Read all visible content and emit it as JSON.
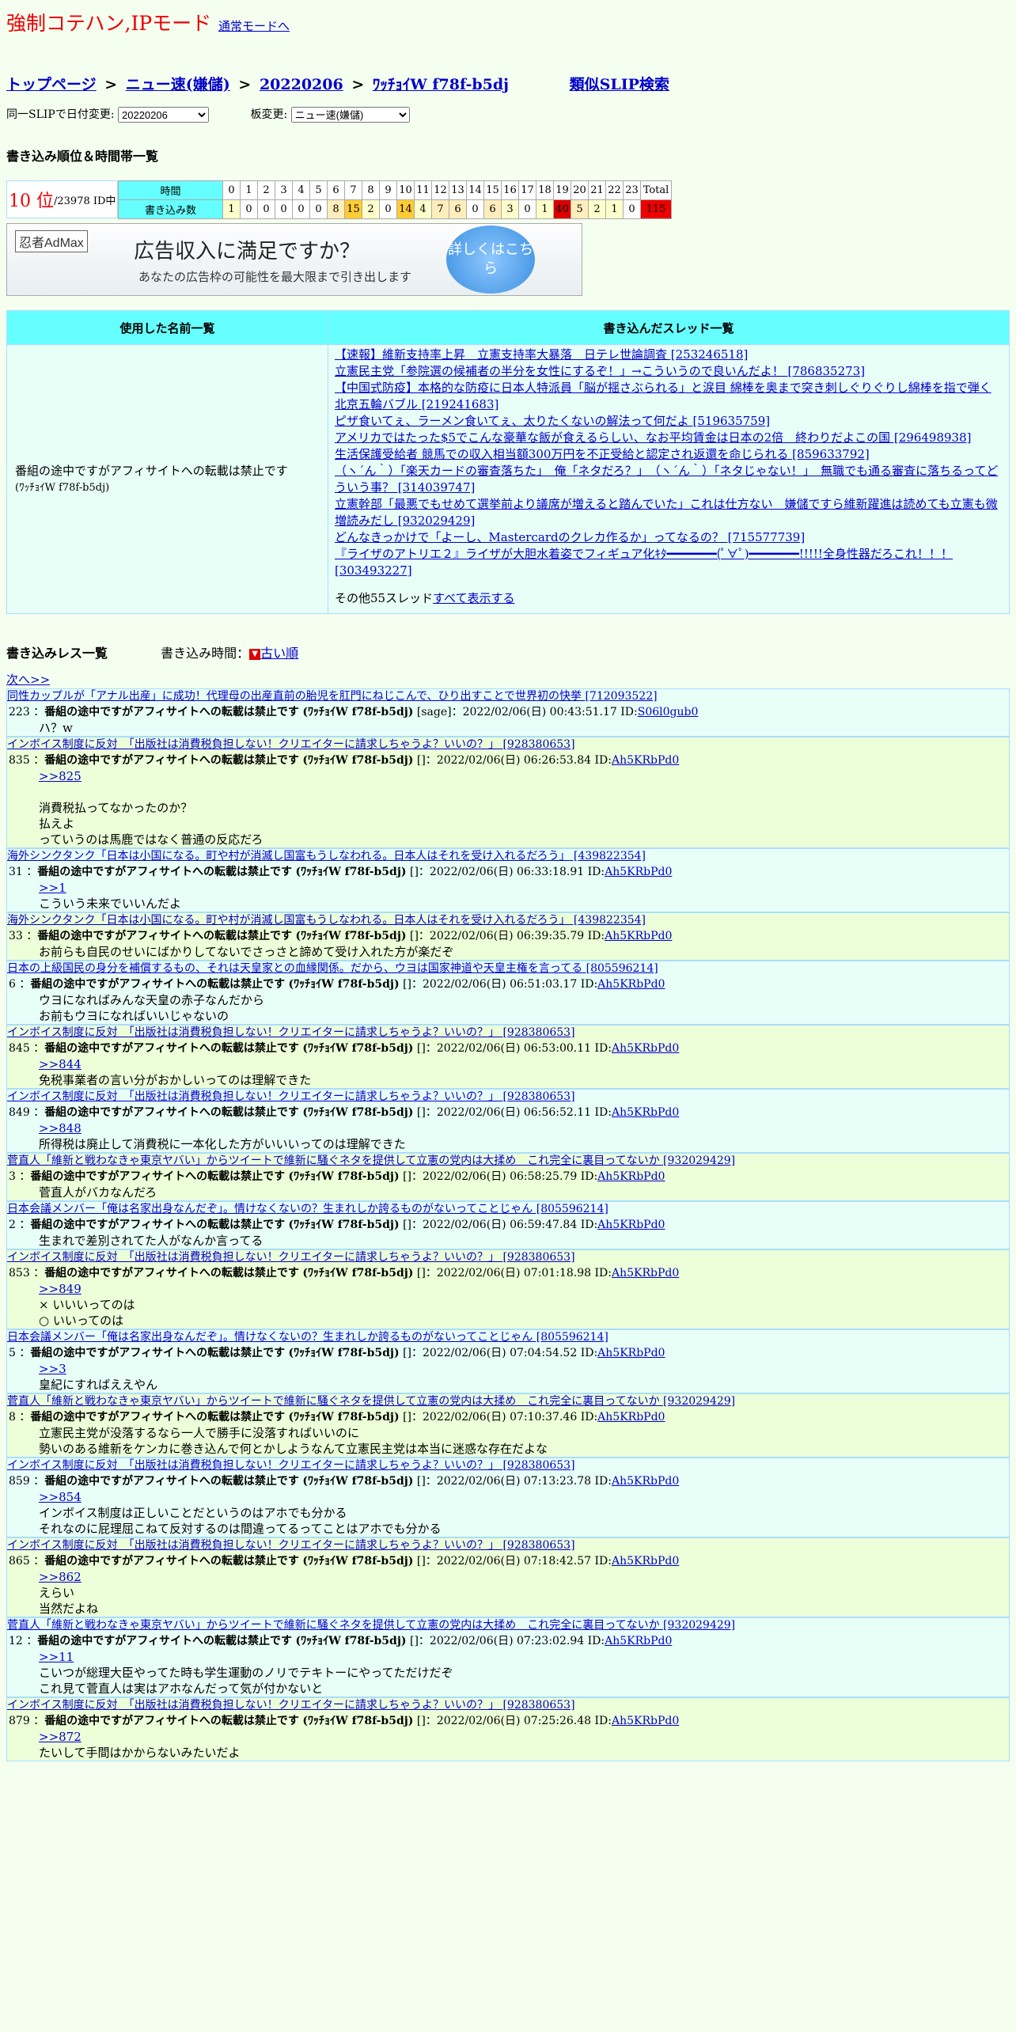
{
  "mode_title": "強制コテハン,IPモード",
  "normal_mode_link": "通常モードへ",
  "breadcrumb": {
    "top": "トップページ",
    "sep": ">",
    "board": "ニュー速(嫌儲)",
    "date": "20220206",
    "slip": "ﾜｯﾁｮｲW f78f-b5dj",
    "similar": "類似SLIP検索"
  },
  "selectors": {
    "date_label": "同一SLIPで日付変更:",
    "date_value": "20220206",
    "board_label": "板変更:",
    "board_value": "ニュー速(嫌儲)"
  },
  "rank_section_title": "書き込み順位＆時間帯一覧",
  "rank": {
    "value": "10 位",
    "total": "/23978 ID中"
  },
  "hours_table": {
    "time_label": "時間",
    "count_label": "書き込み数",
    "total_label": "Total",
    "hours": [
      "0",
      "1",
      "2",
      "3",
      "4",
      "5",
      "6",
      "7",
      "8",
      "9",
      "10",
      "11",
      "12",
      "13",
      "14",
      "15",
      "16",
      "17",
      "18",
      "19",
      "20",
      "21",
      "22",
      "23"
    ],
    "counts": [
      "1",
      "0",
      "0",
      "0",
      "0",
      "0",
      "8",
      "15",
      "2",
      "0",
      "14",
      "4",
      "7",
      "6",
      "0",
      "6",
      "3",
      "0",
      "1",
      "40",
      "5",
      "2",
      "1",
      "0"
    ],
    "total": "115",
    "colors": [
      "#ffffcc",
      "#ffffff",
      "#ffffff",
      "#ffffff",
      "#ffffff",
      "#ffffff",
      "#ffeebb",
      "#ffcc33",
      "#ffffcc",
      "#ffffff",
      "#ffcc33",
      "#ffffcc",
      "#ffeebb",
      "#ffeebb",
      "#ffffff",
      "#ffeebb",
      "#ffffcc",
      "#ffffff",
      "#ffffcc",
      "#dd0000",
      "#ffeebb",
      "#ffffcc",
      "#ffffcc",
      "#ffffff"
    ],
    "total_color": "#ee0000"
  },
  "ad": {
    "brand": "忍者AdMax",
    "headline": "広告収入に満足ですか？",
    "sub": "あなたの広告枠の可能性を最大限まで引き出します",
    "button": "詳しくはこちら"
  },
  "main_table": {
    "col_names": "使用した名前一覧",
    "col_threads": "書き込んだスレッド一覧",
    "name": "番組の途中ですがアフィサイトへの転載は禁止です",
    "name_slip": "(ﾜｯﾁｮｲW f78f-b5dj)",
    "threads": [
      "【速報】維新支持率上昇　立憲支持率大暴落　日テレ世論調査 [253246518]",
      "立憲民主党「参院選の候補者の半分を女性にするぞ！」→こういうので良いんだよ！ [786835273]",
      "【中国式防疫】本格的な防疫に日本人特派員「脳が揺さぶられる」と涙目 綿棒を奥まで突き刺しぐりぐりし綿棒を指で弾く 北京五輪バブル [219241683]",
      "ピザ食いてぇ、ラーメン食いてぇ、太りたくないの解法って何だよ [519635759]",
      "アメリカではたった$5でこんな豪華な飯が食えるらしい、なお平均賃金は日本の2倍　終わりだよこの国 [296498938]",
      "生活保護受給者 競馬での収入相当額300万円を不正受給と認定され返還を命じられる [859633792]",
      "（ヽ´ん｀）「楽天カードの審査落ちた」　俺「ネタだろ？」　（ヽ´ん｀）「ネタじゃない！」　無職でも通る審査に落ちるってどういう事？ [314039747]",
      "立憲幹部「最悪でもせめて選挙前より議席が増えると踏んでいた」これは仕方ない　嫌儲ですら維新躍進は読めても立憲も微増読みだし [932029429]",
      "どんなきっかけで「よーし、Mastercardのクレカ作るか」ってなるの？ [715577739]",
      "『ライザのアトリエ２』ライザが大胆水着姿でフィギュア化ｷﾀ━━━━━━━(ﾟ∀ﾟ)━━━━━━━!!!!!全身性器だろこれ！！！ [303493227]"
    ],
    "more_text": "その他55スレッド",
    "more_link": "すべて表示する"
  },
  "res_section": {
    "title": "書き込みレス一覧",
    "time_label": "書き込み時間：",
    "old_icon": "▼",
    "old_link": "古い順",
    "next": "次へ>>"
  },
  "posts": [
    {
      "thread": "同性カップルが「アナル出産」に成功！代理母の出産直前の胎児を肛門にねじこんで、ひり出すことで世界初の快挙 [712093522]",
      "no": "223",
      "name": "番組の途中ですがアフィサイトへの転載は禁止です",
      "slip": "(ﾜｯﾁｮｲW f78f-b5dj)",
      "mail": "[sage]",
      "date": "2022/02/06(日) 00:43:51.17",
      "id_label": "ID:",
      "id": "S06l0gub0",
      "anchor": "",
      "lines": [
        "ハ？w"
      ]
    },
    {
      "thread": "インボイス制度に反対　「出版社は消費税負担しない！クリエイターに請求しちゃうよ？いいの？」 [928380653]",
      "no": "835",
      "name": "番組の途中ですがアフィサイトへの転載は禁止です",
      "slip": "(ﾜｯﾁｮｲW f78f-b5dj)",
      "mail": "[]",
      "date": "2022/02/06(日) 06:26:53.84",
      "id_label": "ID:",
      "id": "Ah5KRbPd0",
      "anchor": ">>825",
      "lines": [
        "",
        "消費税払ってなかったのか？",
        "払えよ",
        "っていうのは馬鹿ではなく普通の反応だろ"
      ]
    },
    {
      "thread": "海外シンクタンク「日本は小国になる。町や村が消滅し国富もうしなわれる。日本人はそれを受け入れるだろう」 [439822354]",
      "no": "31",
      "name": "番組の途中ですがアフィサイトへの転載は禁止です",
      "slip": "(ﾜｯﾁｮｲW f78f-b5dj)",
      "mail": "[]",
      "date": "2022/02/06(日) 06:33:18.91",
      "id_label": "ID:",
      "id": "Ah5KRbPd0",
      "anchor": ">>1",
      "lines": [
        "こういう未来でいいんだよ"
      ]
    },
    {
      "thread": "海外シンクタンク「日本は小国になる。町や村が消滅し国富もうしなわれる。日本人はそれを受け入れるだろう」 [439822354]",
      "no": "33",
      "name": "番組の途中ですがアフィサイトへの転載は禁止です",
      "slip": "(ﾜｯﾁｮｲW f78f-b5dj)",
      "mail": "[]",
      "date": "2022/02/06(日) 06:39:35.79",
      "id_label": "ID:",
      "id": "Ah5KRbPd0",
      "anchor": "",
      "lines": [
        "お前らも自民のせいにばかりしてないでさっさと諦めて受け入れた方が楽だぞ"
      ]
    },
    {
      "thread": "日本の上級国民の身分を補償するもの、それは天皇家との血縁関係。だから、ウヨは国家神道や天皇主権を言ってる [805596214]",
      "no": "6",
      "name": "番組の途中ですがアフィサイトへの転載は禁止です",
      "slip": "(ﾜｯﾁｮｲW f78f-b5dj)",
      "mail": "[]",
      "date": "2022/02/06(日) 06:51:03.17",
      "id_label": "ID:",
      "id": "Ah5KRbPd0",
      "anchor": "",
      "lines": [
        "ウヨになればみんな天皇の赤子なんだから",
        "お前もウヨになればいいじゃないの"
      ]
    },
    {
      "thread": "インボイス制度に反対　「出版社は消費税負担しない！クリエイターに請求しちゃうよ？いいの？」 [928380653]",
      "no": "845",
      "name": "番組の途中ですがアフィサイトへの転載は禁止です",
      "slip": "(ﾜｯﾁｮｲW f78f-b5dj)",
      "mail": "[]",
      "date": "2022/02/06(日) 06:53:00.11",
      "id_label": "ID:",
      "id": "Ah5KRbPd0",
      "anchor": ">>844",
      "lines": [
        "免税事業者の言い分がおかしいってのは理解できた"
      ]
    },
    {
      "thread": "インボイス制度に反対　「出版社は消費税負担しない！クリエイターに請求しちゃうよ？いいの？」 [928380653]",
      "no": "849",
      "name": "番組の途中ですがアフィサイトへの転載は禁止です",
      "slip": "(ﾜｯﾁｮｲW f78f-b5dj)",
      "mail": "[]",
      "date": "2022/02/06(日) 06:56:52.11",
      "id_label": "ID:",
      "id": "Ah5KRbPd0",
      "anchor": ">>848",
      "lines": [
        "所得税は廃止して消費税に一本化した方がいいいってのは理解できた"
      ]
    },
    {
      "thread": "菅直人「維新と戦わなきゃ東京ヤバい」からツイートで維新に騒ぐネタを提供して立憲の党内は大揉め　これ完全に裏目ってないか [932029429]",
      "no": "3",
      "name": "番組の途中ですがアフィサイトへの転載は禁止です",
      "slip": "(ﾜｯﾁｮｲW f78f-b5dj)",
      "mail": "[]",
      "date": "2022/02/06(日) 06:58:25.79",
      "id_label": "ID:",
      "id": "Ah5KRbPd0",
      "anchor": "",
      "lines": [
        "菅直人がバカなんだろ"
      ]
    },
    {
      "thread": "日本会議メンバー「俺は名家出身なんだぞ」。情けなくないの？生まれしか誇るものがないってことじゃん [805596214]",
      "no": "2",
      "name": "番組の途中ですがアフィサイトへの転載は禁止です",
      "slip": "(ﾜｯﾁｮｲW f78f-b5dj)",
      "mail": "[]",
      "date": "2022/02/06(日) 06:59:47.84",
      "id_label": "ID:",
      "id": "Ah5KRbPd0",
      "anchor": "",
      "lines": [
        "生まれで差別されてた人がなんか言ってる"
      ]
    },
    {
      "thread": "インボイス制度に反対　「出版社は消費税負担しない！クリエイターに請求しちゃうよ？いいの？」 [928380653]",
      "no": "853",
      "name": "番組の途中ですがアフィサイトへの転載は禁止です",
      "slip": "(ﾜｯﾁｮｲW f78f-b5dj)",
      "mail": "[]",
      "date": "2022/02/06(日) 07:01:18.98",
      "id_label": "ID:",
      "id": "Ah5KRbPd0",
      "anchor": ">>849",
      "lines": [
        "× いいいってのは",
        "○ いいってのは"
      ]
    },
    {
      "thread": "日本会議メンバー「俺は名家出身なんだぞ」。情けなくないの？生まれしか誇るものがないってことじゃん [805596214]",
      "no": "5",
      "name": "番組の途中ですがアフィサイトへの転載は禁止です",
      "slip": "(ﾜｯﾁｮｲW f78f-b5dj)",
      "mail": "[]",
      "date": "2022/02/06(日) 07:04:54.52",
      "id_label": "ID:",
      "id": "Ah5KRbPd0",
      "anchor": ">>3",
      "lines": [
        "皇紀にすればええやん"
      ]
    },
    {
      "thread": "菅直人「維新と戦わなきゃ東京ヤバい」からツイートで維新に騒ぐネタを提供して立憲の党内は大揉め　これ完全に裏目ってないか [932029429]",
      "no": "8",
      "name": "番組の途中ですがアフィサイトへの転載は禁止です",
      "slip": "(ﾜｯﾁｮｲW f78f-b5dj)",
      "mail": "[]",
      "date": "2022/02/06(日) 07:10:37.46",
      "id_label": "ID:",
      "id": "Ah5KRbPd0",
      "anchor": "",
      "lines": [
        "立憲民主党が没落するなら一人で勝手に没落すればいいのに",
        "勢いのある維新をケンカに巻き込んで何とかしようなんて立憲民主党は本当に迷惑な存在だよな"
      ]
    },
    {
      "thread": "インボイス制度に反対　「出版社は消費税負担しない！クリエイターに請求しちゃうよ？いいの？」 [928380653]",
      "no": "859",
      "name": "番組の途中ですがアフィサイトへの転載は禁止です",
      "slip": "(ﾜｯﾁｮｲW f78f-b5dj)",
      "mail": "[]",
      "date": "2022/02/06(日) 07:13:23.78",
      "id_label": "ID:",
      "id": "Ah5KRbPd0",
      "anchor": ">>854",
      "lines": [
        "インボイス制度は正しいことだというのはアホでも分かる",
        "それなのに屁理屈こねて反対するのは間違ってるってことはアホでも分かる"
      ]
    },
    {
      "thread": "インボイス制度に反対　「出版社は消費税負担しない！クリエイターに請求しちゃうよ？いいの？」 [928380653]",
      "no": "865",
      "name": "番組の途中ですがアフィサイトへの転載は禁止です",
      "slip": "(ﾜｯﾁｮｲW f78f-b5dj)",
      "mail": "[]",
      "date": "2022/02/06(日) 07:18:42.57",
      "id_label": "ID:",
      "id": "Ah5KRbPd0",
      "anchor": ">>862",
      "lines": [
        "えらい",
        "当然だよね"
      ]
    },
    {
      "thread": "菅直人「維新と戦わなきゃ東京ヤバい」からツイートで維新に騒ぐネタを提供して立憲の党内は大揉め　これ完全に裏目ってないか [932029429]",
      "no": "12",
      "name": "番組の途中ですがアフィサイトへの転載は禁止です",
      "slip": "(ﾜｯﾁｮｲW f78f-b5dj)",
      "mail": "[]",
      "date": "2022/02/06(日) 07:23:02.94",
      "id_label": "ID:",
      "id": "Ah5KRbPd0",
      "anchor": ">>11",
      "lines": [
        "こいつが総理大臣やってた時も学生運動のノリでテキトーにやってただけだぞ",
        "これ見て菅直人は実はアホなんだって気が付かないと"
      ]
    },
    {
      "thread": "インボイス制度に反対　「出版社は消費税負担しない！クリエイターに請求しちゃうよ？いいの？」 [928380653]",
      "no": "879",
      "name": "番組の途中ですがアフィサイトへの転載は禁止です",
      "slip": "(ﾜｯﾁｮｲW f78f-b5dj)",
      "mail": "[]",
      "date": "2022/02/06(日) 07:25:26.48",
      "id_label": "ID:",
      "id": "Ah5KRbPd0",
      "anchor": ">>872",
      "lines": [
        "たいして手間はかからないみたいだよ"
      ]
    }
  ]
}
